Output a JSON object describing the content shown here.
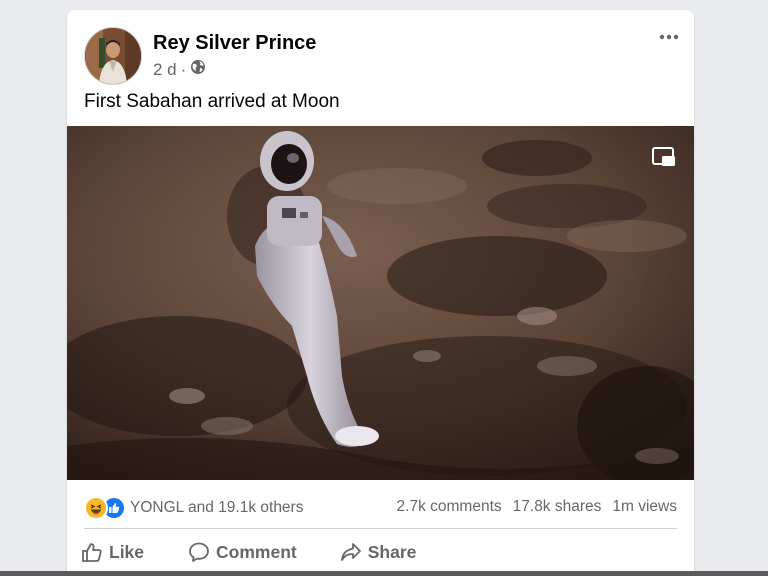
{
  "post": {
    "author": "Rey Silver Prince",
    "time": "2 d",
    "separator": "·",
    "audience_icon": "globe-icon",
    "text": "First Sabahan arrived at Moon",
    "more_icon": "more-options-icon",
    "video_control_icon": "picture-in-picture-icon"
  },
  "engagement": {
    "reaction_icons": [
      "haha-reaction-icon",
      "like-reaction-icon"
    ],
    "reactors": "YONGL and 19.1k others",
    "comments": "2.7k comments",
    "shares": "17.8k shares",
    "views": "1m views"
  },
  "actions": {
    "like": "Like",
    "comment": "Comment",
    "share": "Share"
  },
  "colors": {
    "text_primary": "#050505",
    "text_secondary": "#65676b",
    "like_blue": "#1877f2",
    "haha_yellow": "#f7b928",
    "background": "#e9ebee"
  }
}
